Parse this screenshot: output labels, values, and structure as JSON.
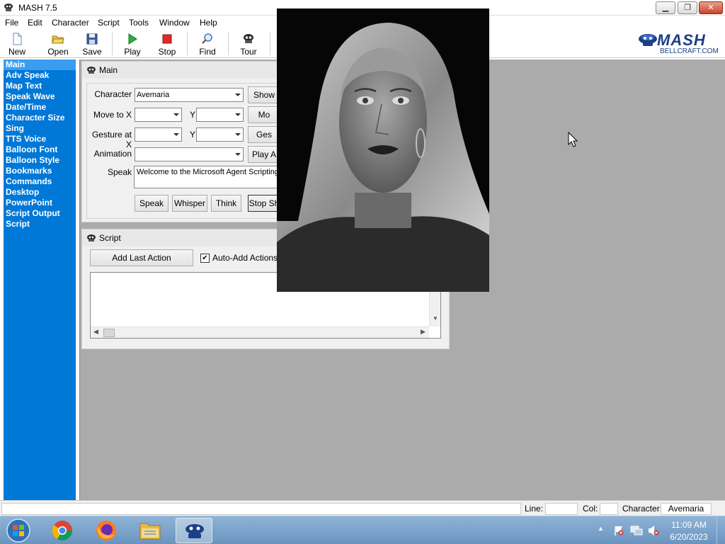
{
  "window": {
    "title": "MASH 7.5",
    "controls": {
      "minimize": "▁",
      "maximize": "❐",
      "close": "✕"
    }
  },
  "menubar": [
    "File",
    "Edit",
    "Character",
    "Script",
    "Tools",
    "Window",
    "Help"
  ],
  "toolbar": {
    "new": "New",
    "open": "Open",
    "save": "Save",
    "play": "Play",
    "stop": "Stop",
    "find": "Find",
    "tour": "Tour"
  },
  "brand": {
    "logo": "MASH",
    "site": "BELLCRAFT.COM"
  },
  "sidebar": [
    "Main",
    "Adv Speak",
    "Map Text",
    "Speak Wave",
    "Date/Time",
    "Character Size",
    "Sing",
    "TTS Voice",
    "Balloon Font",
    "Balloon Style",
    "Bookmarks",
    "Commands",
    "Desktop",
    "PowerPoint",
    "Script Output",
    "Script"
  ],
  "main_panel": {
    "title": "Main",
    "character_label": "Character",
    "character_value": "Avemaria",
    "show_button": "Show",
    "move_to_label": "Move to X",
    "y_label": "Y",
    "move_button": "Mo",
    "gesture_at_label": "Gesture at X",
    "gesture_button": "Ges",
    "animation_label": "Animation",
    "play_anim_button": "Play A",
    "speak_label": "Speak",
    "speak_text": "Welcome to the Microsoft Agent Scripting",
    "speak_button": "Speak",
    "whisper_button": "Whisper",
    "think_button": "Think",
    "stop_button": "Stop Sh"
  },
  "script_panel": {
    "title": "Script",
    "add_last_action": "Add Last Action",
    "auto_add_label": "Auto-Add Actions to",
    "auto_add_checked": "✔"
  },
  "statusbar": {
    "line_label": "Line:",
    "col_label": "Col:",
    "character_label": "Character:",
    "character_value": "Avemaria"
  },
  "taskbar": {
    "time": "11:09 AM",
    "date": "6/20/2023",
    "tray_up": "▲"
  },
  "colors": {
    "sidebar": "#0078d7",
    "sidebar_active": "#3b9df0",
    "workspace": "#ababab",
    "taskbar": "#7aa3cc"
  }
}
